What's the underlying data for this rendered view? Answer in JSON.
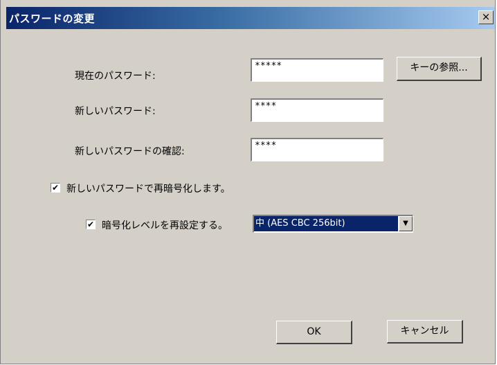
{
  "window": {
    "title": "パスワードの変更",
    "close_symbol": "×"
  },
  "fields": {
    "current_label": "現在のパスワード:",
    "current_value": "*****",
    "new_label": "新しいパスワード:",
    "new_value": "****",
    "confirm_label": "新しいパスワードの確認:",
    "confirm_value": "****"
  },
  "buttons": {
    "key_browse": "キーの参照...",
    "ok": "OK",
    "cancel": "キャンセル"
  },
  "options": {
    "reencrypt_label": "新しいパスワードで再暗号化します。",
    "reencrypt_checked": true,
    "reset_level_label": "暗号化レベルを再設定する。",
    "reset_level_checked": true,
    "encryption_level_value": "中 (AES CBC 256bit)"
  },
  "icons": {
    "checkmark": "✔",
    "dropdown": "▼"
  }
}
